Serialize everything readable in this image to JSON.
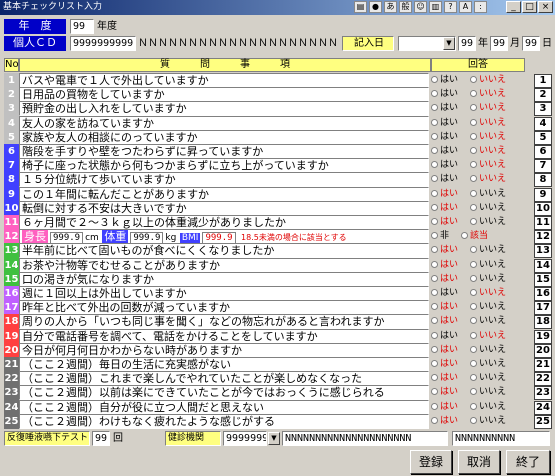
{
  "title": "基本チェックリスト入力",
  "toolbar_icons": [
    "printer-icon",
    "globe-icon",
    "hiragana-icon",
    "kanji-icon",
    "face-icon",
    "notebook-icon",
    "help-icon",
    "caps-icon",
    "dash-icon"
  ],
  "window_buttons": [
    "_",
    "□",
    "×"
  ],
  "header": {
    "year_label": "年　度",
    "year_value": "99",
    "year_suffix": "年度",
    "id_label": "個人ＣＤ",
    "id_value": "9999999999",
    "name_value": "ＮＮＮＮＮＮＮＮＮＮＮＮＮＮＮＮＮＮＮＮ",
    "date_label": "記入日",
    "date_year": "99",
    "date_month": "99",
    "date_day": "99",
    "year_char": "年",
    "month_char": "月",
    "day_char": "日"
  },
  "table_header": {
    "no": "No",
    "question": "質　　　問　　　事　　　項",
    "answer": "回答"
  },
  "answer_labels": {
    "yes": "はい",
    "no": "いいえ",
    "alt_yes": "非",
    "alt_no": "該当"
  },
  "rows": [
    {
      "n": "1",
      "q": "バスや電車で１人で外出していますか",
      "c": "#c0c0c0",
      "yes_red": false,
      "no_red": true
    },
    {
      "n": "2",
      "q": "日用品の買物をしていますか",
      "c": "#c0c0c0",
      "yes_red": false,
      "no_red": true
    },
    {
      "n": "3",
      "q": "預貯金の出し入れをしていますか",
      "c": "#c0c0c0",
      "yes_red": false,
      "no_red": true
    },
    {
      "n": "4",
      "q": "友人の家を訪ねていますか",
      "c": "#c0c0c0",
      "yes_red": false,
      "no_red": true
    },
    {
      "n": "5",
      "q": "家族や友人の相談にのっていますか",
      "c": "#c0c0c0",
      "yes_red": false,
      "no_red": true
    },
    {
      "n": "6",
      "q": "階段を手すりや壁をつたわらずに昇っていますか",
      "c": "#4040ff",
      "yes_red": false,
      "no_red": true
    },
    {
      "n": "7",
      "q": "椅子に座った状態から何もつかまらずに立ち上がっていますか",
      "c": "#4040ff",
      "yes_red": false,
      "no_red": true
    },
    {
      "n": "8",
      "q": "１５分位続けて歩いていますか",
      "c": "#4040ff",
      "yes_red": false,
      "no_red": true
    },
    {
      "n": "9",
      "q": "この１年間に転んだことがありますか",
      "c": "#4040ff",
      "yes_red": true,
      "no_red": false
    },
    {
      "n": "10",
      "q": "転倒に対する不安は大きいですか",
      "c": "#4040ff",
      "yes_red": true,
      "no_red": false
    },
    {
      "n": "11",
      "q": "６ヶ月間で２～３ｋｇ以上の体重減少がありましたか",
      "c": "#ff60c0",
      "yes_red": true,
      "no_red": false
    },
    {
      "n": "12",
      "q": "",
      "c": "#ff60c0",
      "yes_red": false,
      "no_red": true,
      "special": true
    },
    {
      "n": "13",
      "q": "半年前に比べて固いものが食べにくくなりましたか",
      "c": "#40c040",
      "yes_red": true,
      "no_red": false
    },
    {
      "n": "14",
      "q": "お茶や汁物等でむせることがありますか",
      "c": "#40c040",
      "yes_red": true,
      "no_red": false
    },
    {
      "n": "15",
      "q": "口の渇きが気になりますか",
      "c": "#40c040",
      "yes_red": true,
      "no_red": false
    },
    {
      "n": "16",
      "q": "週に１回以上は外出していますか",
      "c": "#c060ff",
      "yes_red": false,
      "no_red": true
    },
    {
      "n": "17",
      "q": "昨年と比べて外出の回数が減っていますか",
      "c": "#c060ff",
      "yes_red": true,
      "no_red": false
    },
    {
      "n": "18",
      "q": "周りの人から「いつも同じ事を聞く」などの物忘れがあると言われますか",
      "c": "#ff4040",
      "yes_red": true,
      "no_red": false
    },
    {
      "n": "19",
      "q": "自分で電話番号を調べて、電話をかけることをしていますか",
      "c": "#ff4040",
      "yes_red": false,
      "no_red": true
    },
    {
      "n": "20",
      "q": "今日が何月何日かわからない時がありますか",
      "c": "#ff4040",
      "yes_red": true,
      "no_red": false
    },
    {
      "n": "21",
      "q": "（ここ２週間）毎日の生活に充実感がない",
      "c": "#707070",
      "yes_red": true,
      "no_red": false
    },
    {
      "n": "22",
      "q": "（ここ２週間）これまで楽しんでやれていたことが楽しめなくなった",
      "c": "#707070",
      "yes_red": true,
      "no_red": false
    },
    {
      "n": "23",
      "q": "（ここ２週間）以前は楽にできていたことが今ではおっくうに感じられる",
      "c": "#707070",
      "yes_red": true,
      "no_red": false
    },
    {
      "n": "24",
      "q": "（ここ２週間）自分が役に立つ人間だと思えない",
      "c": "#707070",
      "yes_red": true,
      "no_red": false
    },
    {
      "n": "25",
      "q": "（ここ２週間）わけもなく疲れたような感じがする",
      "c": "#707070",
      "yes_red": true,
      "no_red": false
    }
  ],
  "row12": {
    "height_label": "身長",
    "height_value": "999.9",
    "height_unit": "cm",
    "weight_label": "体重",
    "weight_value": "999.9",
    "weight_unit": "kg",
    "bmi_label": "BMI",
    "bmi_value": "999.9",
    "bmi_note": "18.5未満の場合に該当とする"
  },
  "footer": {
    "test_label": "反復唾液嚥下テスト",
    "test_value": "99",
    "test_unit": "回",
    "org_label": "健診機関",
    "org_code": "9999999",
    "org_name": "NNNNNNNNNNNNNNNNNNNNN",
    "org_name2": "NNNNNNNNNN"
  },
  "buttons": {
    "register": "登録",
    "cancel": "取消",
    "exit": "終了"
  }
}
